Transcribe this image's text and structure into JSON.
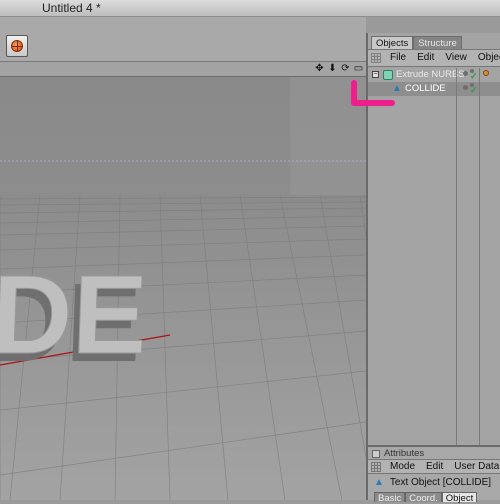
{
  "window": {
    "title": "Untitled 4 *"
  },
  "toolbar": {
    "render_icon": "render-globe-icon"
  },
  "viewport": {
    "header_icons": [
      "move-icon",
      "down-arrow-icon",
      "rotate-icon",
      "maximize-icon"
    ],
    "text_3d": "DE"
  },
  "objects_panel": {
    "tabs": [
      {
        "label": "Objects",
        "active": true
      },
      {
        "label": "Structure",
        "active": false
      }
    ],
    "menu": [
      "File",
      "Edit",
      "View",
      "Objects"
    ],
    "tree": [
      {
        "label": "Extrude NURBS",
        "type": "nurbs",
        "level": 0,
        "expanded": true
      },
      {
        "label": "COLLIDE",
        "type": "text",
        "level": 1,
        "selected": true
      }
    ],
    "highlight_color": "#ee1e8c"
  },
  "attributes_panel": {
    "title": "Attributes",
    "menu": [
      "Mode",
      "Edit",
      "User Data"
    ],
    "object_info": "Text Object [COLLIDE]",
    "tabs": [
      {
        "label": "Basic",
        "active": false
      },
      {
        "label": "Coord.",
        "active": false
      },
      {
        "label": "Object",
        "active": true
      }
    ]
  }
}
